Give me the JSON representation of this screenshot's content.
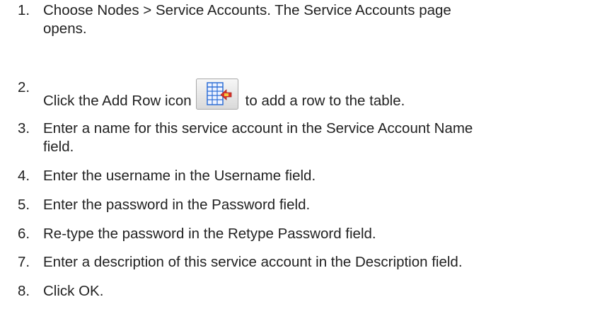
{
  "steps": [
    {
      "number": "1.",
      "lines": [
        "Choose Nodes > Service Accounts. The Service Accounts page",
        "opens."
      ]
    },
    {
      "number": "2.",
      "before": "Click the Add Row icon",
      "icon": "add-row-icon",
      "after": "to add a row to the table."
    },
    {
      "number": "3.",
      "lines": [
        "Enter a name for this service account in the Service Account Name",
        "field."
      ]
    },
    {
      "number": "4.",
      "lines": [
        "Enter the username in the Username field."
      ]
    },
    {
      "number": "5.",
      "lines": [
        "Enter the password in the Password field."
      ]
    },
    {
      "number": "6.",
      "lines": [
        "Re-type the password in the Retype Password field."
      ]
    },
    {
      "number": "7.",
      "lines": [
        "Enter a description of this service account in the Description field."
      ]
    },
    {
      "number": "8.",
      "lines": [
        "Click OK."
      ]
    }
  ],
  "colors": {
    "text": "#222222",
    "icon_frame": "#a9a9a9",
    "icon_grid": "#2f6fd6",
    "icon_arrow": "#d9342b"
  }
}
